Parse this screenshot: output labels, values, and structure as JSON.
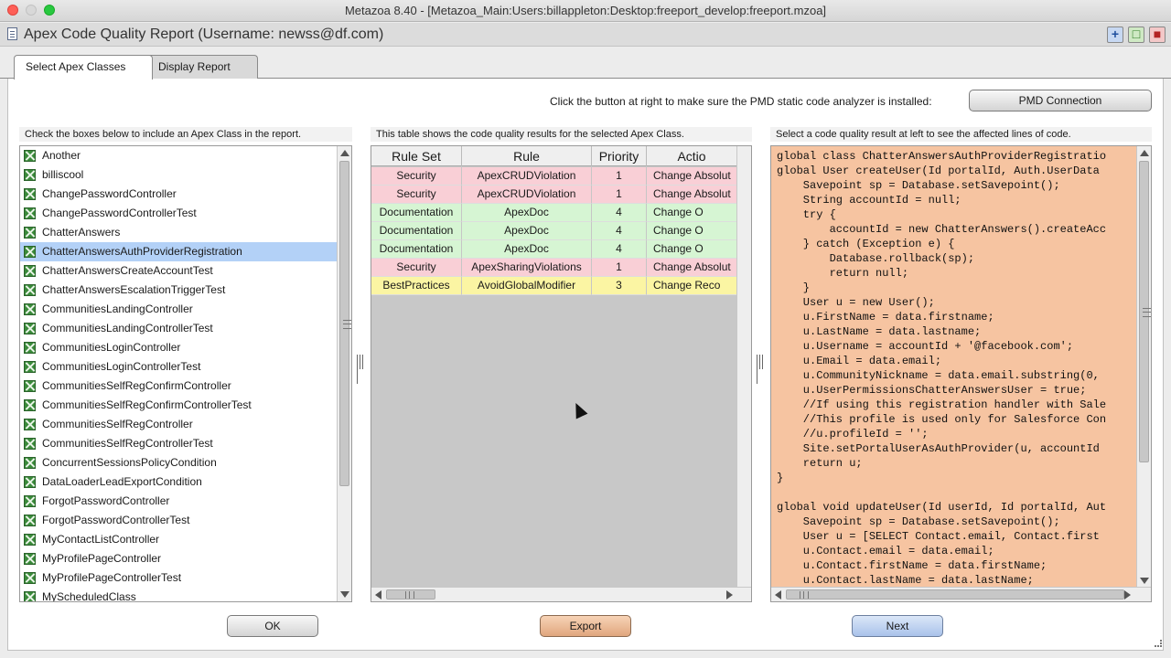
{
  "window": {
    "title": "Metazoa 8.40 - [Metazoa_Main:Users:billappleton:Desktop:freeport_develop:freeport.mzoa]"
  },
  "app": {
    "title": "Apex Code Quality Report (Username: newss@df.com)"
  },
  "tabs": [
    {
      "label": "Select Apex Classes",
      "active": true
    },
    {
      "label": "Display Report",
      "active": false
    }
  ],
  "pmd": {
    "instruction": "Click the button at right to make sure the PMD static code analyzer is installed:",
    "button_label": "PMD Connection"
  },
  "classes_panel": {
    "hint": "Check the boxes below to include an Apex Class in the report.",
    "items": [
      {
        "name": "Another",
        "checked": true,
        "selected": false
      },
      {
        "name": "billiscool",
        "checked": true,
        "selected": false
      },
      {
        "name": "ChangePasswordController",
        "checked": true,
        "selected": false
      },
      {
        "name": "ChangePasswordControllerTest",
        "checked": true,
        "selected": false
      },
      {
        "name": "ChatterAnswers",
        "checked": true,
        "selected": false
      },
      {
        "name": "ChatterAnswersAuthProviderRegistration",
        "checked": true,
        "selected": true
      },
      {
        "name": "ChatterAnswersCreateAccountTest",
        "checked": true,
        "selected": false
      },
      {
        "name": "ChatterAnswersEscalationTriggerTest",
        "checked": true,
        "selected": false
      },
      {
        "name": "CommunitiesLandingController",
        "checked": true,
        "selected": false
      },
      {
        "name": "CommunitiesLandingControllerTest",
        "checked": true,
        "selected": false
      },
      {
        "name": "CommunitiesLoginController",
        "checked": true,
        "selected": false
      },
      {
        "name": "CommunitiesLoginControllerTest",
        "checked": true,
        "selected": false
      },
      {
        "name": "CommunitiesSelfRegConfirmController",
        "checked": true,
        "selected": false
      },
      {
        "name": "CommunitiesSelfRegConfirmControllerTest",
        "checked": true,
        "selected": false
      },
      {
        "name": "CommunitiesSelfRegController",
        "checked": true,
        "selected": false
      },
      {
        "name": "CommunitiesSelfRegControllerTest",
        "checked": true,
        "selected": false
      },
      {
        "name": "ConcurrentSessionsPolicyCondition",
        "checked": true,
        "selected": false
      },
      {
        "name": "DataLoaderLeadExportCondition",
        "checked": true,
        "selected": false
      },
      {
        "name": "ForgotPasswordController",
        "checked": true,
        "selected": false
      },
      {
        "name": "ForgotPasswordControllerTest",
        "checked": true,
        "selected": false
      },
      {
        "name": "MyContactListController",
        "checked": true,
        "selected": false
      },
      {
        "name": "MyProfilePageController",
        "checked": true,
        "selected": false
      },
      {
        "name": "MyProfilePageControllerTest",
        "checked": true,
        "selected": false
      },
      {
        "name": "MyScheduledClass",
        "checked": true,
        "selected": false
      }
    ]
  },
  "results_panel": {
    "hint": "This table shows the code quality results for the selected Apex Class.",
    "columns": [
      "Rule Set",
      "Rule",
      "Priority",
      "Actio"
    ],
    "rows": [
      {
        "rule_set": "Security",
        "rule": "ApexCRUDViolation",
        "priority": "1",
        "action": "Change Absolut",
        "color": "#f9cfd6"
      },
      {
        "rule_set": "Security",
        "rule": "ApexCRUDViolation",
        "priority": "1",
        "action": "Change Absolut",
        "color": "#f9cfd6"
      },
      {
        "rule_set": "Documentation",
        "rule": "ApexDoc",
        "priority": "4",
        "action": "Change O",
        "color": "#d6f5d3"
      },
      {
        "rule_set": "Documentation",
        "rule": "ApexDoc",
        "priority": "4",
        "action": "Change O",
        "color": "#d6f5d3"
      },
      {
        "rule_set": "Documentation",
        "rule": "ApexDoc",
        "priority": "4",
        "action": "Change O",
        "color": "#d6f5d3"
      },
      {
        "rule_set": "Security",
        "rule": "ApexSharingViolations",
        "priority": "1",
        "action": "Change Absolut",
        "color": "#f9cfd6"
      },
      {
        "rule_set": "BestPractices",
        "rule": "AvoidGlobalModifier",
        "priority": "3",
        "action": "Change Reco",
        "color": "#fbf5a3"
      }
    ]
  },
  "code_panel": {
    "hint": "Select a code quality result at left to see the affected lines of code.",
    "lines": [
      "global class ChatterAnswersAuthProviderRegistratio",
      "global User createUser(Id portalId, Auth.UserData",
      "    Savepoint sp = Database.setSavepoint();",
      "    String accountId = null;",
      "    try {",
      "        accountId = new ChatterAnswers().createAcc",
      "    } catch (Exception e) {",
      "        Database.rollback(sp);",
      "        return null;",
      "    }",
      "    User u = new User();",
      "    u.FirstName = data.firstname;",
      "    u.LastName = data.lastname;",
      "    u.Username = accountId + '@facebook.com';",
      "    u.Email = data.email;",
      "    u.CommunityNickname = data.email.substring(0,",
      "    u.UserPermissionsChatterAnswersUser = true;",
      "    //If using this registration handler with Sale",
      "    //This profile is used only for Salesforce Con",
      "    //u.profileId = '';",
      "    Site.setPortalUserAsAuthProvider(u, accountId",
      "    return u;",
      "}",
      "",
      "global void updateUser(Id userId, Id portalId, Aut",
      "    Savepoint sp = Database.setSavepoint();",
      "    User u = [SELECT Contact.email, Contact.first",
      "    u.Contact.email = data.email;",
      "    u.Contact.firstName = data.firstName;",
      "    u.Contact.lastName = data.lastName;"
    ]
  },
  "footer": {
    "ok_label": "OK",
    "export_label": "Export",
    "next_label": "Next"
  }
}
